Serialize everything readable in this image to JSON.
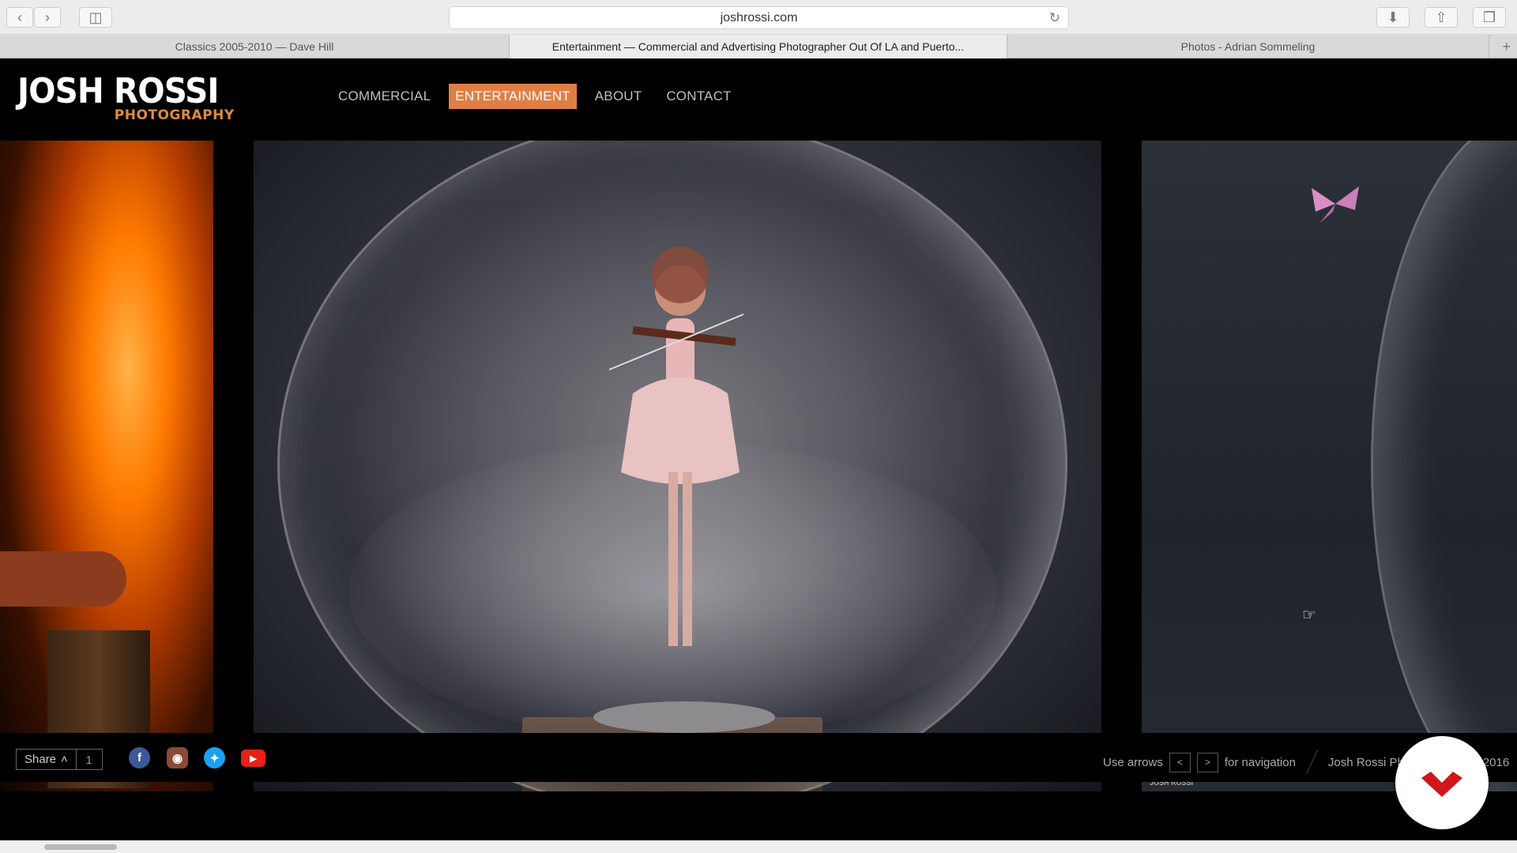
{
  "browser": {
    "url": "joshrossi.com",
    "tabs": [
      {
        "title": "Classics 2005-2010 — Dave Hill",
        "active": false
      },
      {
        "title": "Entertainment — Commercial and Advertising Photographer Out Of LA and Puerto...",
        "active": true
      },
      {
        "title": "Photos - Adrian Sommeling",
        "active": false
      }
    ]
  },
  "site": {
    "logo_main": "JOSH ROSSI",
    "logo_sub": "PHOTOGRAPHY",
    "nav": [
      {
        "label": "COMMERCIAL",
        "active": false
      },
      {
        "label": "ENTERTAINMENT",
        "active": true
      },
      {
        "label": "ABOUT",
        "active": false
      },
      {
        "label": "CONTACT",
        "active": false
      }
    ],
    "accent_color": "#e07f45"
  },
  "gallery": {
    "watermark": "JOSH ROSSI"
  },
  "footer": {
    "share_label": "Share",
    "share_count": "1",
    "nav_hint_prefix": "Use arrows",
    "nav_hint_suffix": "for navigation",
    "copyright": "Josh Rossi Ph",
    "copyright_year": "2016",
    "social": [
      "facebook-icon",
      "instagram-icon",
      "twitter-icon",
      "youtube-icon"
    ]
  }
}
